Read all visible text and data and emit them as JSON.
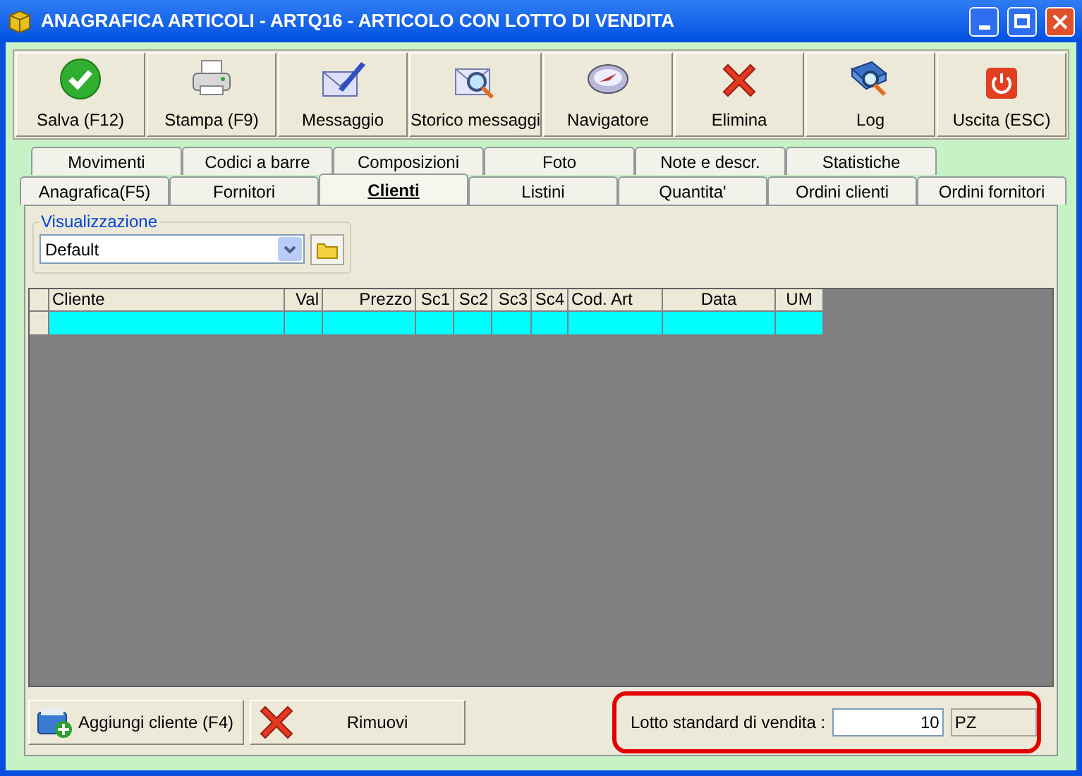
{
  "window": {
    "title": "ANAGRAFICA ARTICOLI - ARTQ16 - ARTICOLO CON LOTTO DI VENDITA"
  },
  "toolbar": [
    {
      "label": "Salva (F12)",
      "kind": "check"
    },
    {
      "label": "Stampa (F9)",
      "kind": "printer"
    },
    {
      "label": "Messaggio",
      "kind": "mail"
    },
    {
      "label": "Storico messaggi",
      "kind": "mailsearch"
    },
    {
      "label": "Navigatore",
      "kind": "compass"
    },
    {
      "label": "Elimina",
      "kind": "cross"
    },
    {
      "label": "Log",
      "kind": "book"
    },
    {
      "label": "Uscita (ESC)",
      "kind": "power"
    }
  ],
  "tabs_back": [
    {
      "label": "Movimenti",
      "selected": false
    },
    {
      "label": "Codici a barre",
      "selected": false
    },
    {
      "label": "Composizioni",
      "selected": false
    },
    {
      "label": "Foto",
      "selected": false
    },
    {
      "label": "Note e descr.",
      "selected": false
    },
    {
      "label": "Statistiche",
      "selected": false
    }
  ],
  "tabs_front": [
    {
      "label": "Anagrafica(F5)",
      "selected": false
    },
    {
      "label": "Fornitori",
      "selected": false
    },
    {
      "label": "Clienti",
      "selected": true
    },
    {
      "label": "Listini",
      "selected": false
    },
    {
      "label": "Quantita'",
      "selected": false
    },
    {
      "label": "Ordini clienti",
      "selected": false
    },
    {
      "label": "Ordini fornitori",
      "selected": false
    }
  ],
  "view_group": {
    "label": "Visualizzazione",
    "value": "Default"
  },
  "table": {
    "columns": [
      {
        "label": "Cliente"
      },
      {
        "label": "Val"
      },
      {
        "label": "Prezzo"
      },
      {
        "label": "Sc1"
      },
      {
        "label": "Sc2"
      },
      {
        "label": "Sc3"
      },
      {
        "label": "Sc4"
      },
      {
        "label": "Cod. Art"
      },
      {
        "label": "Data"
      },
      {
        "label": "UM"
      }
    ],
    "rows": [
      {
        "selected": true
      }
    ]
  },
  "bottom_buttons": [
    {
      "label": "Aggiungi cliente (F4)",
      "kind": "add"
    },
    {
      "label": "Rimuovi",
      "kind": "cross"
    }
  ],
  "lot": {
    "label": "Lotto standard di vendita :",
    "value": "10",
    "unit": "PZ"
  }
}
